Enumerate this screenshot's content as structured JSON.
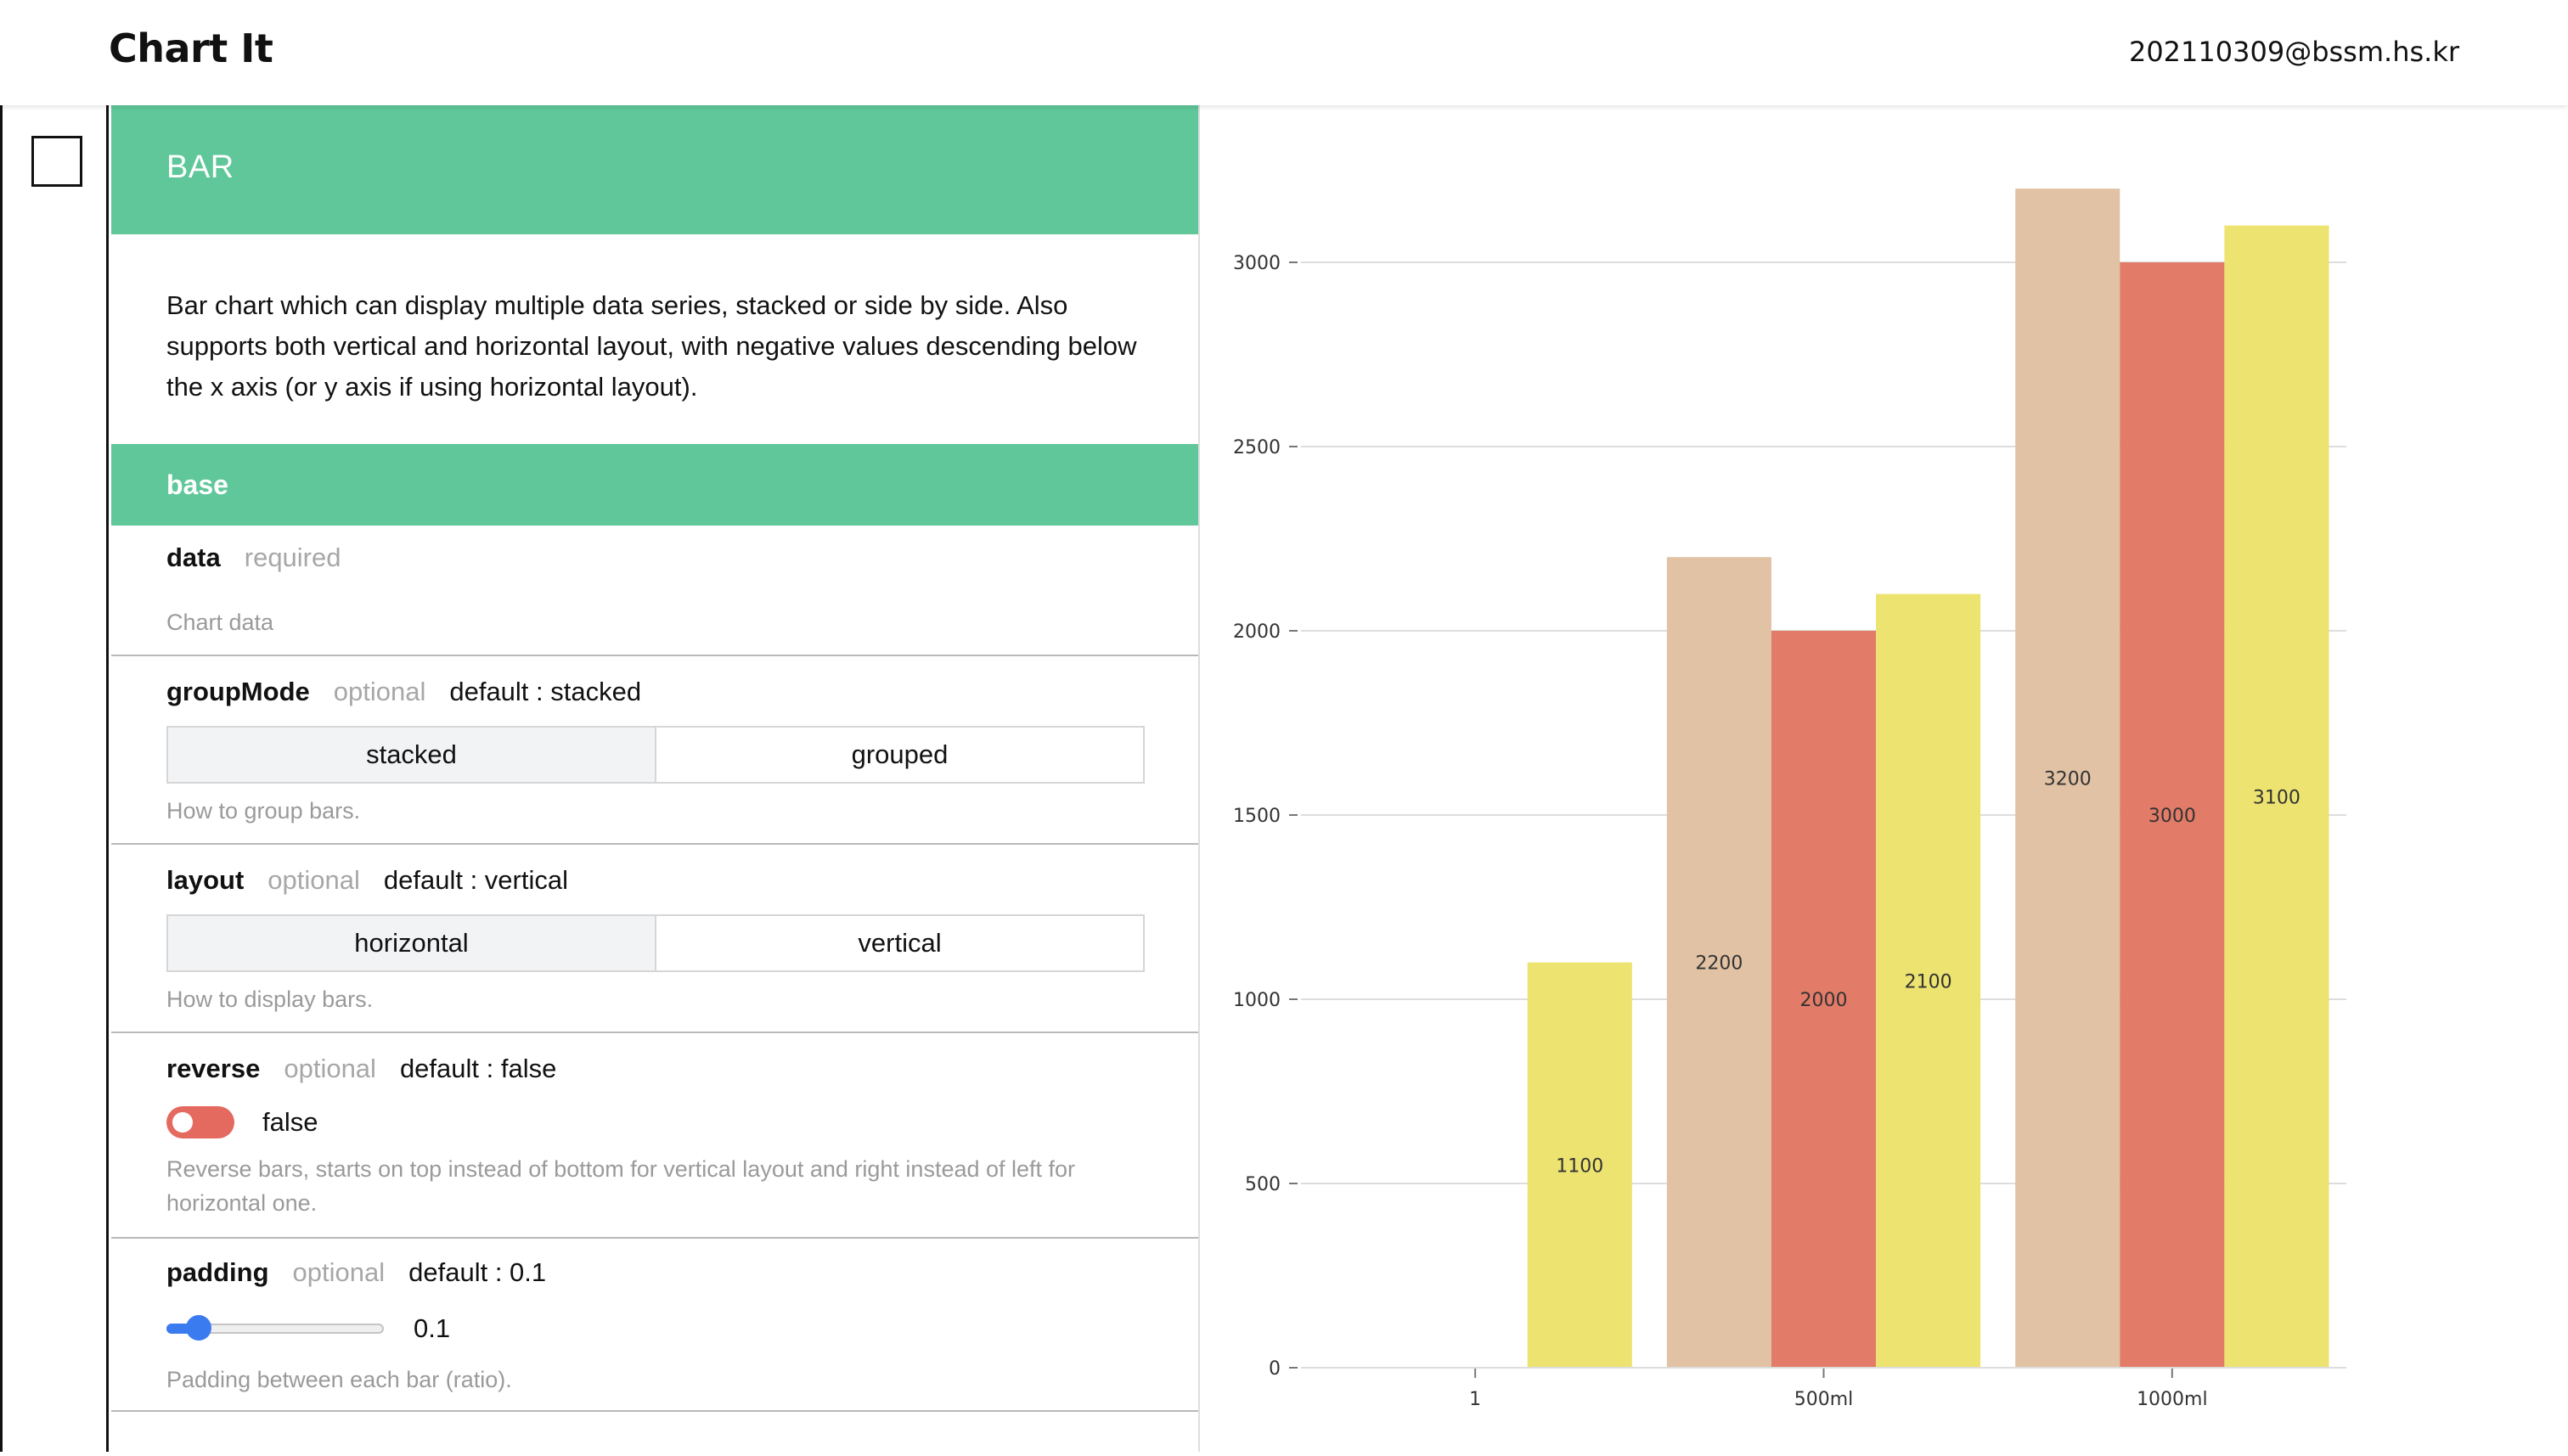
{
  "header": {
    "app_title": "Chart It",
    "user_email": "202110309@bssm.hs.kr"
  },
  "panel": {
    "chart_name": "BAR",
    "description": "Bar chart which can display multiple data series, stacked or side by side. Also supports both vertical and horizontal layout, with negative values descending below the x axis (or y axis if using horizontal layout).",
    "section_title": "base",
    "props": {
      "data": {
        "name": "data",
        "flag": "required",
        "help": "Chart data"
      },
      "groupMode": {
        "name": "groupMode",
        "flag": "optional",
        "default": "default : stacked",
        "options": [
          "stacked",
          "grouped"
        ],
        "selected": "stacked",
        "help": "How to group bars."
      },
      "layout": {
        "name": "layout",
        "flag": "optional",
        "default": "default : vertical",
        "options": [
          "horizontal",
          "vertical"
        ],
        "selected": "horizontal",
        "help": "How to display bars."
      },
      "reverse": {
        "name": "reverse",
        "flag": "optional",
        "default": "default : false",
        "value": "false",
        "help": "Reverse bars, starts on top instead of bottom for vertical layout and right instead of left for horizontal one."
      },
      "padding": {
        "name": "padding",
        "flag": "optional",
        "default": "default : 0.1",
        "value": 0.1,
        "value_label": "0.1",
        "help": "Padding between each bar (ratio)."
      }
    }
  },
  "colors": {
    "accent": "#5fc79a",
    "toggle": "#e46a60",
    "slider": "#3b7bf0"
  },
  "chart_data": {
    "type": "bar",
    "categories": [
      "1",
      "500ml",
      "1000ml"
    ],
    "series": [
      {
        "values": [
          0,
          2200,
          3200
        ],
        "color": "#e1c2a4"
      },
      {
        "values": [
          0,
          2000,
          3000
        ],
        "color": "#e27b67"
      },
      {
        "values": [
          1100,
          2100,
          3100
        ],
        "color": "#ede371"
      }
    ],
    "data_labels": [
      [
        "",
        "2200",
        "3200"
      ],
      [
        "",
        "2000",
        "3000"
      ],
      [
        "1100",
        "2100",
        "3100"
      ]
    ],
    "yticks": [
      0,
      500,
      1000,
      1500,
      2000,
      2500,
      3000
    ],
    "ylim": [
      0,
      3000
    ],
    "grid": true,
    "group_mode": "grouped",
    "xlabel": "",
    "ylabel": ""
  }
}
